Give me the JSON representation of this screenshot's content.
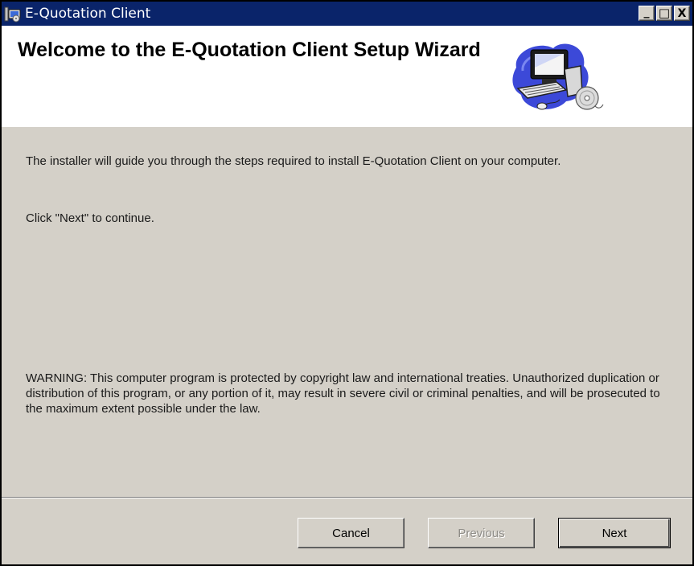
{
  "window": {
    "title": "E-Quotation Client",
    "controls": {
      "minimize": "_",
      "maximize": "□",
      "close": "X"
    }
  },
  "header": {
    "title": "Welcome to the E-Quotation Client Setup Wizard",
    "banner_icon": "computer-with-cd-icon"
  },
  "body": {
    "intro": "The installer will guide you through the steps required to install E-Quotation Client on your computer.",
    "next_hint": "Click \"Next\" to continue.",
    "warning": "WARNING: This computer program is protected by copyright law and international treaties. Unauthorized duplication or distribution of this program, or any portion of it, may result in severe civil or criminal penalties, and will be prosecuted to the maximum extent possible under the law."
  },
  "buttons": {
    "cancel": "Cancel",
    "previous": "Previous",
    "next": "Next"
  },
  "colors": {
    "titlebar": "#0a246a",
    "dialog_face": "#d4d0c8",
    "header_bg": "#ffffff",
    "disabled_text": "#8f8d88"
  }
}
